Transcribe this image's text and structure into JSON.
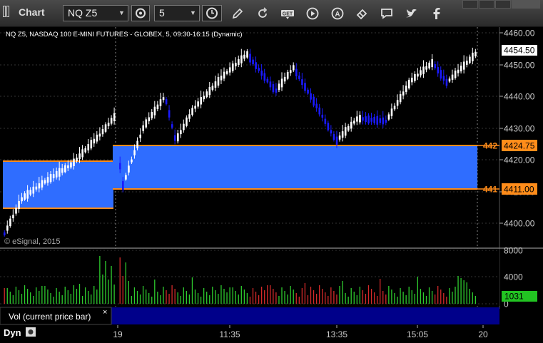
{
  "window": {
    "title": "Chart"
  },
  "toolbar": {
    "symbol": "NQ Z5",
    "interval": "5",
    "icons": [
      "link-icon",
      "clock-icon",
      "pencil-icon",
      "refresh-icon",
      "get-icon",
      "play-icon",
      "a-circle-icon",
      "eraser-icon",
      "chat-icon",
      "twitter-icon",
      "facebook-icon"
    ]
  },
  "chart": {
    "header": "NQ Z5, NASDAQ 100 E-MINI FUTURES - GLOBEX, 5, 09:30-16:15 (Dynamic)",
    "watermark": "© eSignal, 2015",
    "price_ticks": [
      "4460.00",
      "4450.00",
      "4440.00",
      "4430.00",
      "4420.00",
      "4410.00",
      "4400.00"
    ],
    "last_price": "4454.50",
    "level_upper": "4424.75",
    "level_lower": "4411.00",
    "level_upper_short": "442",
    "level_lower_short": "441",
    "volume_ticks": [
      "8000",
      "4000",
      "0"
    ],
    "volume_last": "1031",
    "volume_label": "Vol (current price bar)",
    "volume_close": "×",
    "time_ticks": [
      "19",
      "11:35",
      "13:35",
      "15:05",
      "20"
    ],
    "dyn_label": "Dyn",
    "colors": {
      "band": "#2f6dff",
      "band_line": "#ff8c1a",
      "up": "#ffffff",
      "down": "#1a1aff",
      "vol_up": "#2ecc2e",
      "vol_down": "#d42a2a",
      "vol_badge": "#22c322"
    }
  }
}
